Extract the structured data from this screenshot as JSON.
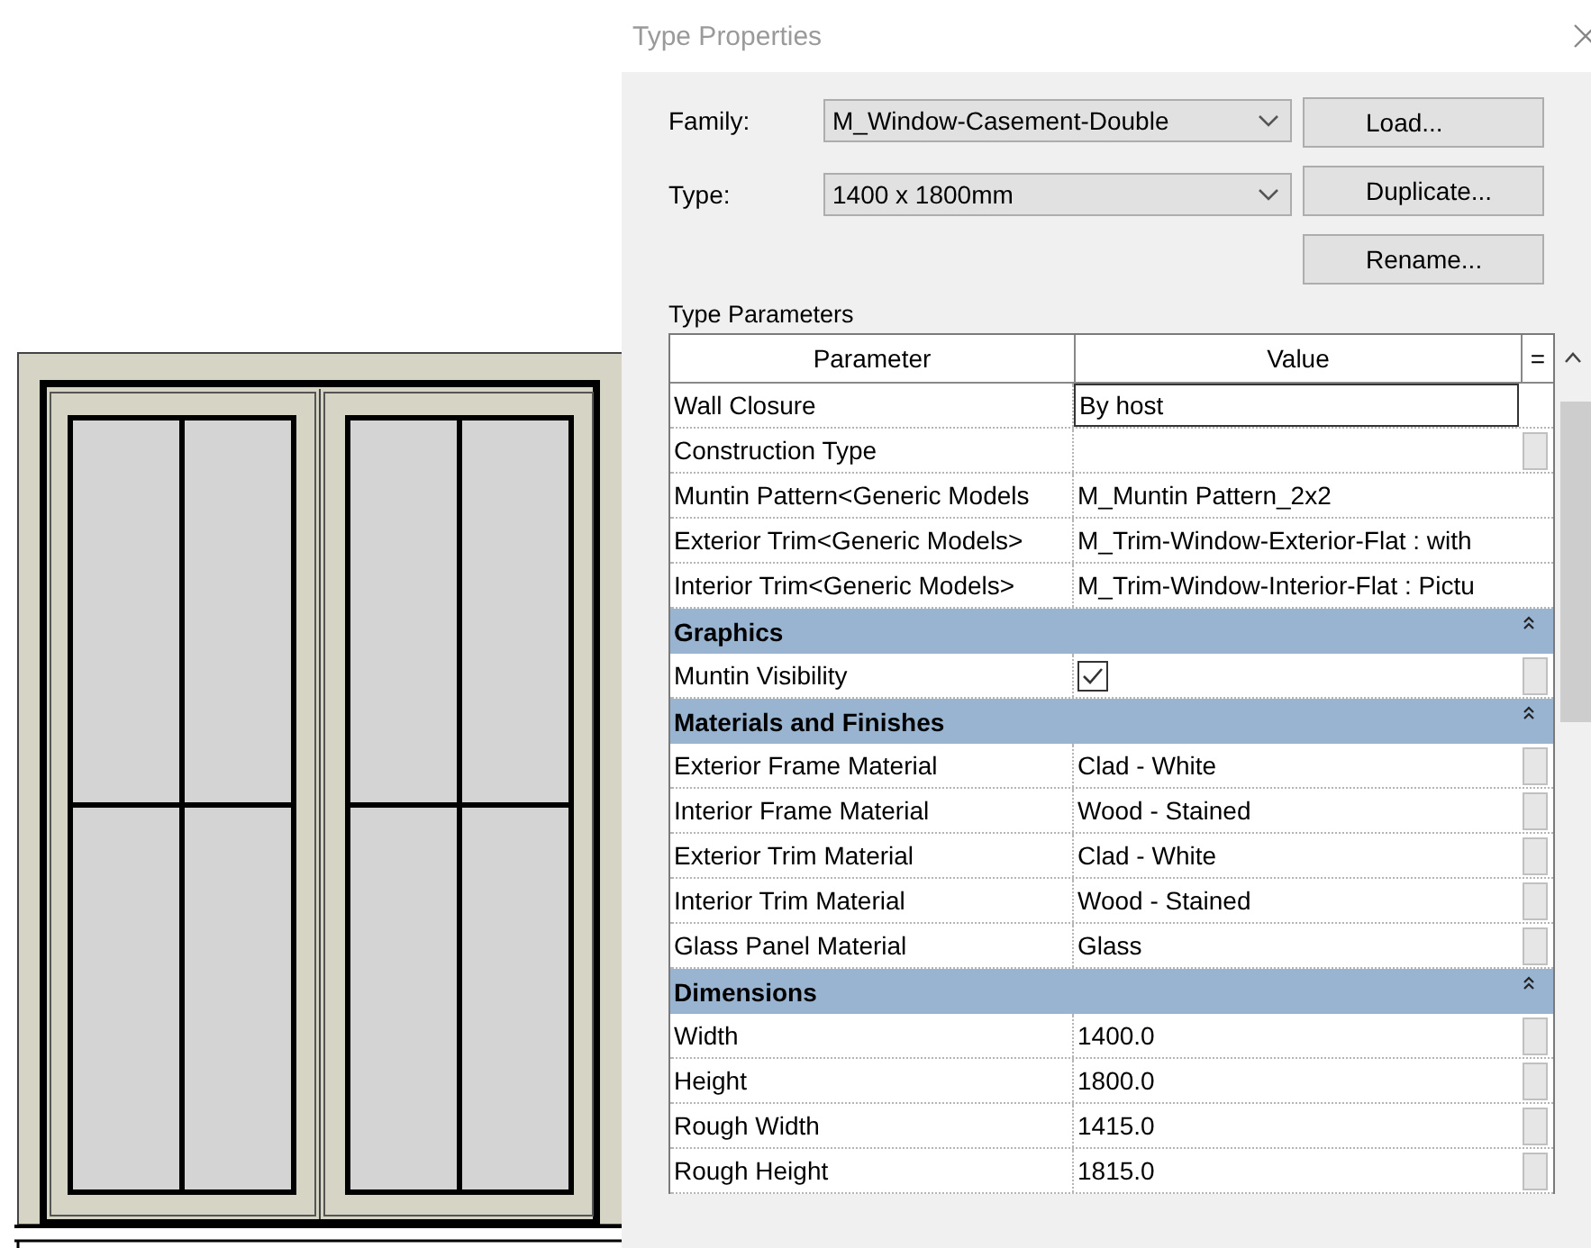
{
  "dialog": {
    "title": "Type Properties",
    "family": {
      "label": "Family:",
      "value": "M_Window-Casement-Double"
    },
    "type": {
      "label": "Type:",
      "value": "1400 x 1800mm"
    },
    "buttons": [
      "Load...",
      "Duplicate...",
      "Rename..."
    ],
    "section_label": "Type Parameters",
    "table": {
      "columns": [
        "Parameter",
        "Value",
        "="
      ],
      "rows": [
        {
          "kind": "param",
          "name": "Wall Closure",
          "value": "By host",
          "selected": true,
          "button": false
        },
        {
          "kind": "param",
          "name": "Construction Type",
          "selected": false,
          "button": true
        },
        {
          "kind": "param",
          "name": "Muntin Pattern<Generic Models",
          "value": "M_Muntin Pattern_2x2",
          "selected": false,
          "button": false
        },
        {
          "kind": "param",
          "name": "Exterior Trim<Generic Models>",
          "value": "M_Trim-Window-Exterior-Flat : with",
          "selected": false,
          "button": false
        },
        {
          "kind": "param",
          "name": "Interior Trim<Generic Models>",
          "value": "M_Trim-Window-Interior-Flat : Pictu",
          "selected": false,
          "button": false
        },
        {
          "kind": "group",
          "name": "Graphics",
          "expanded": true
        },
        {
          "kind": "check",
          "name": "Muntin Visibility",
          "checked": true,
          "selected": false,
          "button": true
        },
        {
          "kind": "group",
          "name": "Materials and Finishes",
          "expanded": true
        },
        {
          "kind": "param",
          "name": "Exterior Frame Material",
          "value": "Clad - White",
          "selected": false,
          "button": true
        },
        {
          "kind": "param",
          "name": "Interior Frame Material",
          "value": "Wood - Stained",
          "selected": false,
          "button": true
        },
        {
          "kind": "param",
          "name": "Exterior Trim Material",
          "value": "Clad - White",
          "selected": false,
          "button": true
        },
        {
          "kind": "param",
          "name": "Interior Trim Material",
          "value": "Wood - Stained",
          "selected": false,
          "button": true
        },
        {
          "kind": "param",
          "name": "Glass Panel Material",
          "value": "Glass",
          "selected": false,
          "button": true
        },
        {
          "kind": "group",
          "name": "Dimensions",
          "expanded": true
        },
        {
          "kind": "param",
          "name": "Width",
          "value": "1400.0",
          "selected": false,
          "button": true
        },
        {
          "kind": "param",
          "name": "Height",
          "value": "1800.0",
          "selected": false,
          "button": true
        },
        {
          "kind": "param",
          "name": "Rough Width",
          "value": "1415.0",
          "selected": false,
          "button": true
        },
        {
          "kind": "param",
          "name": "Rough Height",
          "value": "1815.0",
          "selected": false,
          "button": true
        }
      ]
    }
  }
}
